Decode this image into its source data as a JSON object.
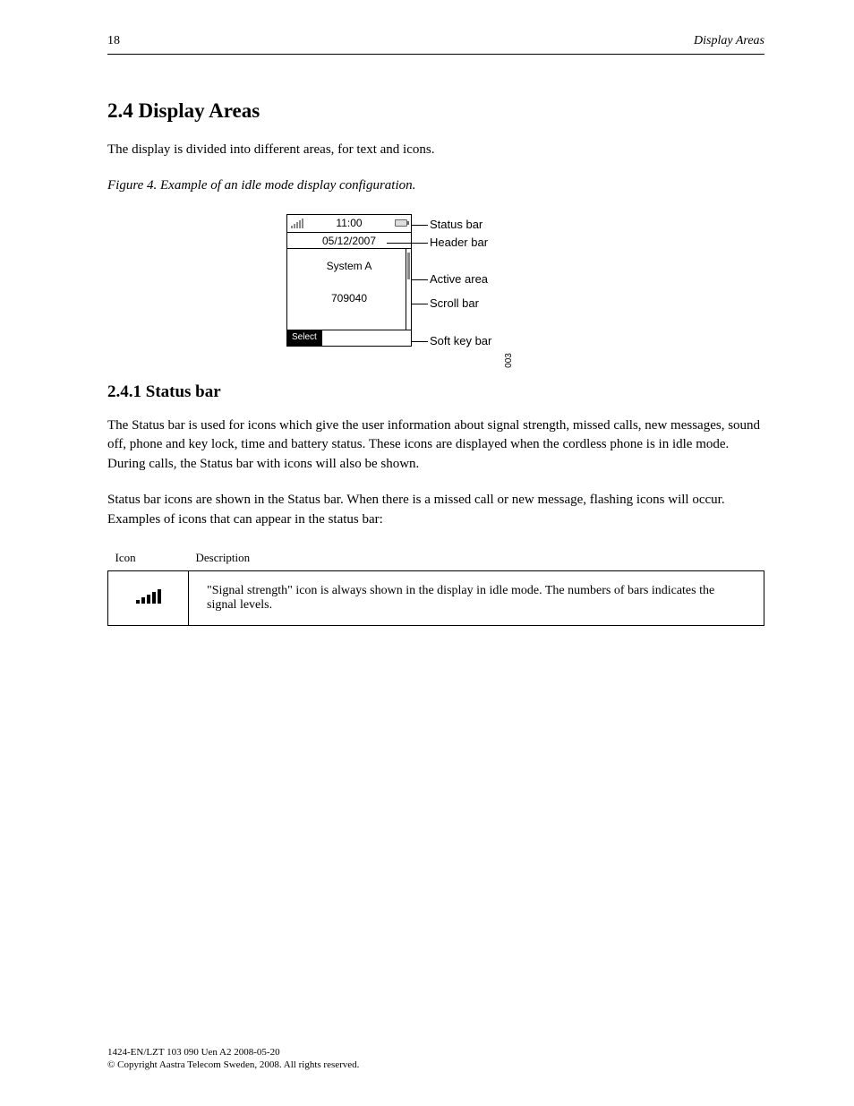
{
  "header": {
    "page_number": "18",
    "running_title": "Display Areas"
  },
  "section": {
    "number_title": "2.4 Display Areas",
    "intro": "The display is divided into different areas, for text and icons.",
    "figure_label": "Figure 4. Example of an idle mode display configuration."
  },
  "device": {
    "time": "11:00",
    "date": "05/12/2007",
    "system": "System A",
    "id": "709040",
    "softkey_left": "Select"
  },
  "callouts": {
    "status": "Status bar",
    "header": "Header bar",
    "active": "Active area",
    "scroll": "Scroll bar",
    "softkey": "Soft key bar"
  },
  "figure_sidenum": "003",
  "status_bar_section": {
    "title": "2.4.1 Status bar",
    "p1": "The Status bar is used for icons which give the user information about signal strength, missed calls, new messages, sound off, phone and key lock, time and battery status. These icons are displayed when the cordless phone is in idle mode. During calls, the Status bar with icons will also be shown.",
    "p2": "Status bar icons are shown in the Status bar. When there is a missed call or new message, flashing icons will occur. Examples of icons that can appear in the status bar:",
    "table": {
      "col1": "Icon",
      "col2": "Description",
      "signal_desc": "\"Signal strength\" icon is always shown in the display in idle mode. The numbers of bars indicates the signal levels."
    }
  },
  "footer": {
    "line1": "1424-EN/LZT 103 090 Uen A2 2008-05-20",
    "line2": "© Copyright Aastra Telecom Sweden, 2008. All rights reserved."
  }
}
